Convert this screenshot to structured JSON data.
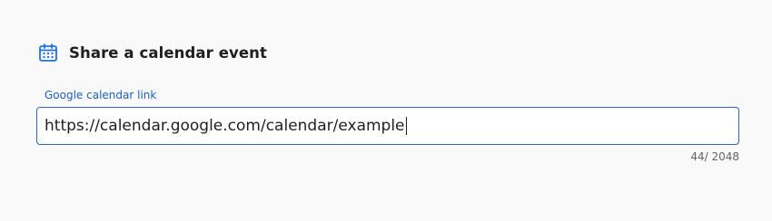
{
  "header": {
    "icon": "calendar-icon",
    "title": "Share a calendar event"
  },
  "field": {
    "label": "Google calendar link",
    "value": "https://calendar.google.com/calendar/example",
    "counter": "44/ 2048"
  },
  "colors": {
    "accent": "#1a5fc8",
    "border": "#2c64c8",
    "icon": "#1a73e8",
    "background": "#f9f9f9"
  }
}
